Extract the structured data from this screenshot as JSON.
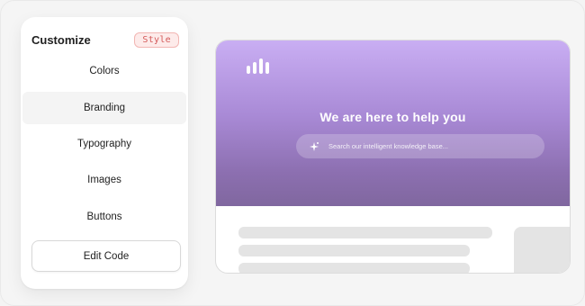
{
  "panel": {
    "title": "Customize",
    "badge": "Style",
    "items": [
      {
        "label": "Colors",
        "active": false
      },
      {
        "label": "Branding",
        "active": true
      },
      {
        "label": "Typography",
        "active": false
      },
      {
        "label": "Images",
        "active": false
      },
      {
        "label": "Buttons",
        "active": false
      }
    ],
    "edit_code": "Edit Code"
  },
  "preview": {
    "logo_icon": "bar-chart-icon",
    "headline": "We are here to help you",
    "search": {
      "placeholder": "Search our intelligent knowledge base...",
      "icon": "sparkle-icon"
    }
  },
  "colors": {
    "hero_top": "#c9aef3",
    "hero_bottom": "#80679f",
    "badge_text": "#d45a5a",
    "badge_bg": "#fdebea"
  }
}
